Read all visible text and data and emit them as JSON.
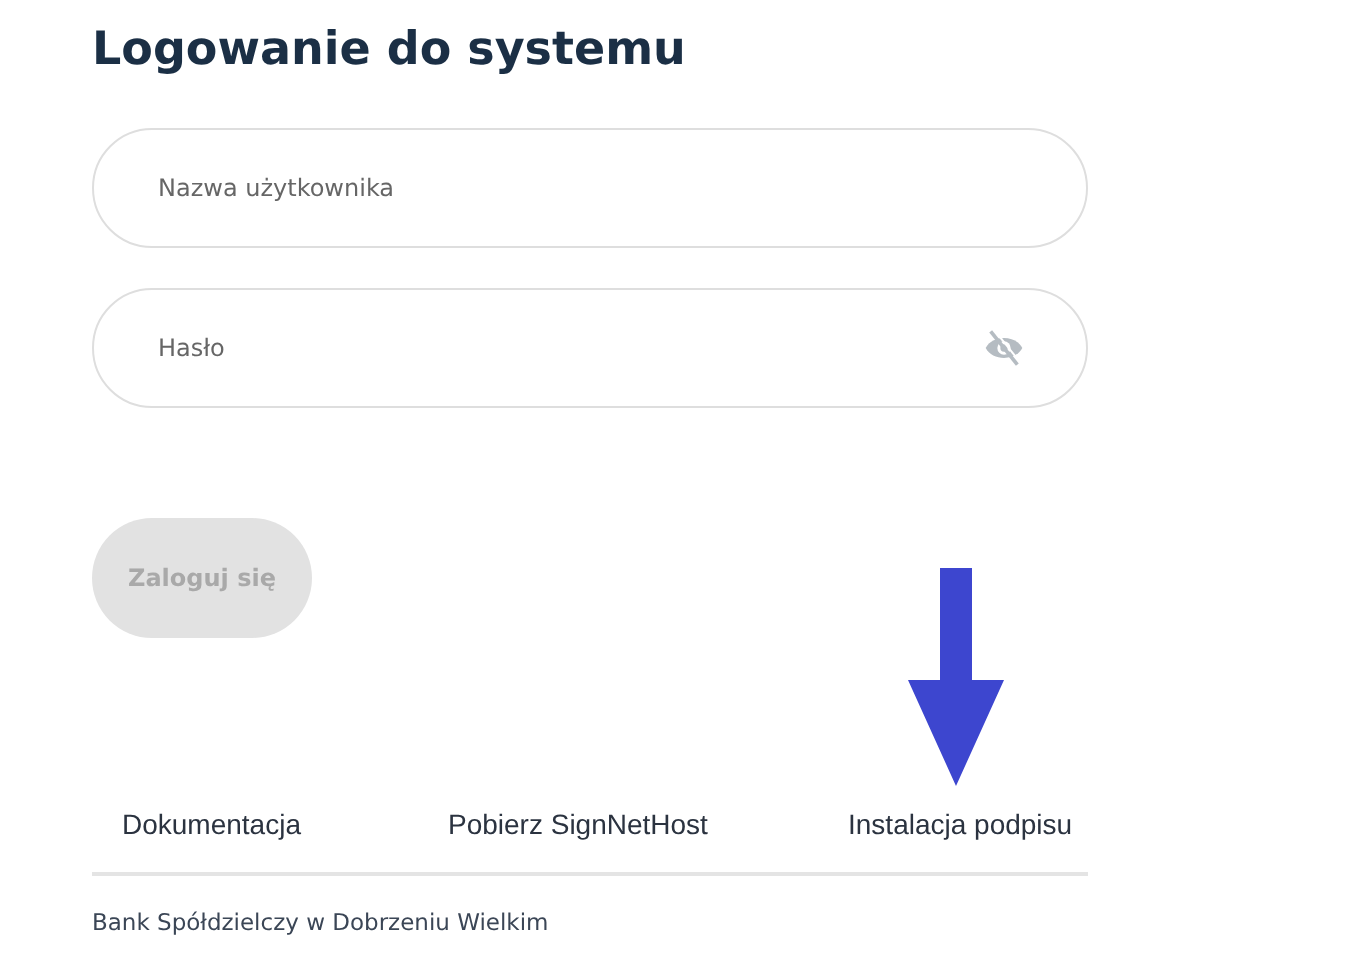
{
  "title": "Logowanie do systemu",
  "fields": [
    {
      "kind": "text",
      "placeholder": "Nazwa użytkownika"
    },
    {
      "kind": "password",
      "placeholder": "Hasło",
      "password_visible": false
    }
  ],
  "login_button": {
    "label": "Zaloguj się",
    "disabled": true
  },
  "links": [
    "Dokumentacja",
    "Pobierz SignNetHost",
    "Instalacja podpisu"
  ],
  "footer": "Bank Spółdzielczy w Dobrzeniu Wielkim"
}
